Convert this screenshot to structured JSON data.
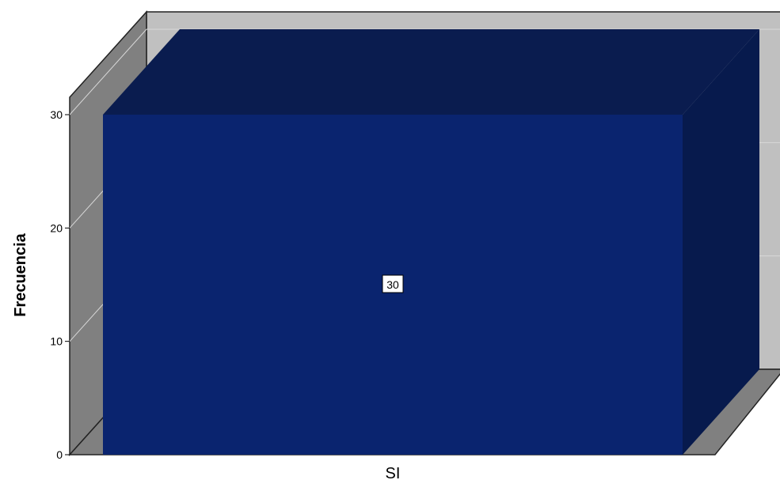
{
  "chart_data": {
    "type": "bar",
    "three_d": true,
    "categories": [
      "SI"
    ],
    "values": [
      30
    ],
    "title": "",
    "xlabel": "",
    "ylabel": "Frecuencia",
    "ylim": [
      0,
      30
    ],
    "yticks": [
      0,
      10,
      20,
      30
    ],
    "data_labels": [
      "30"
    ],
    "grid": true,
    "legend": "none",
    "colors": {
      "bar_front": "#0a246f",
      "bar_top": "#0a1c4f",
      "bar_side": "#071a4d",
      "back_wall": "#c0c0c0",
      "side_wall": "#808080",
      "floor": "#808080",
      "gridline": "#d8d8d8",
      "label_box": "#ffffff"
    }
  }
}
